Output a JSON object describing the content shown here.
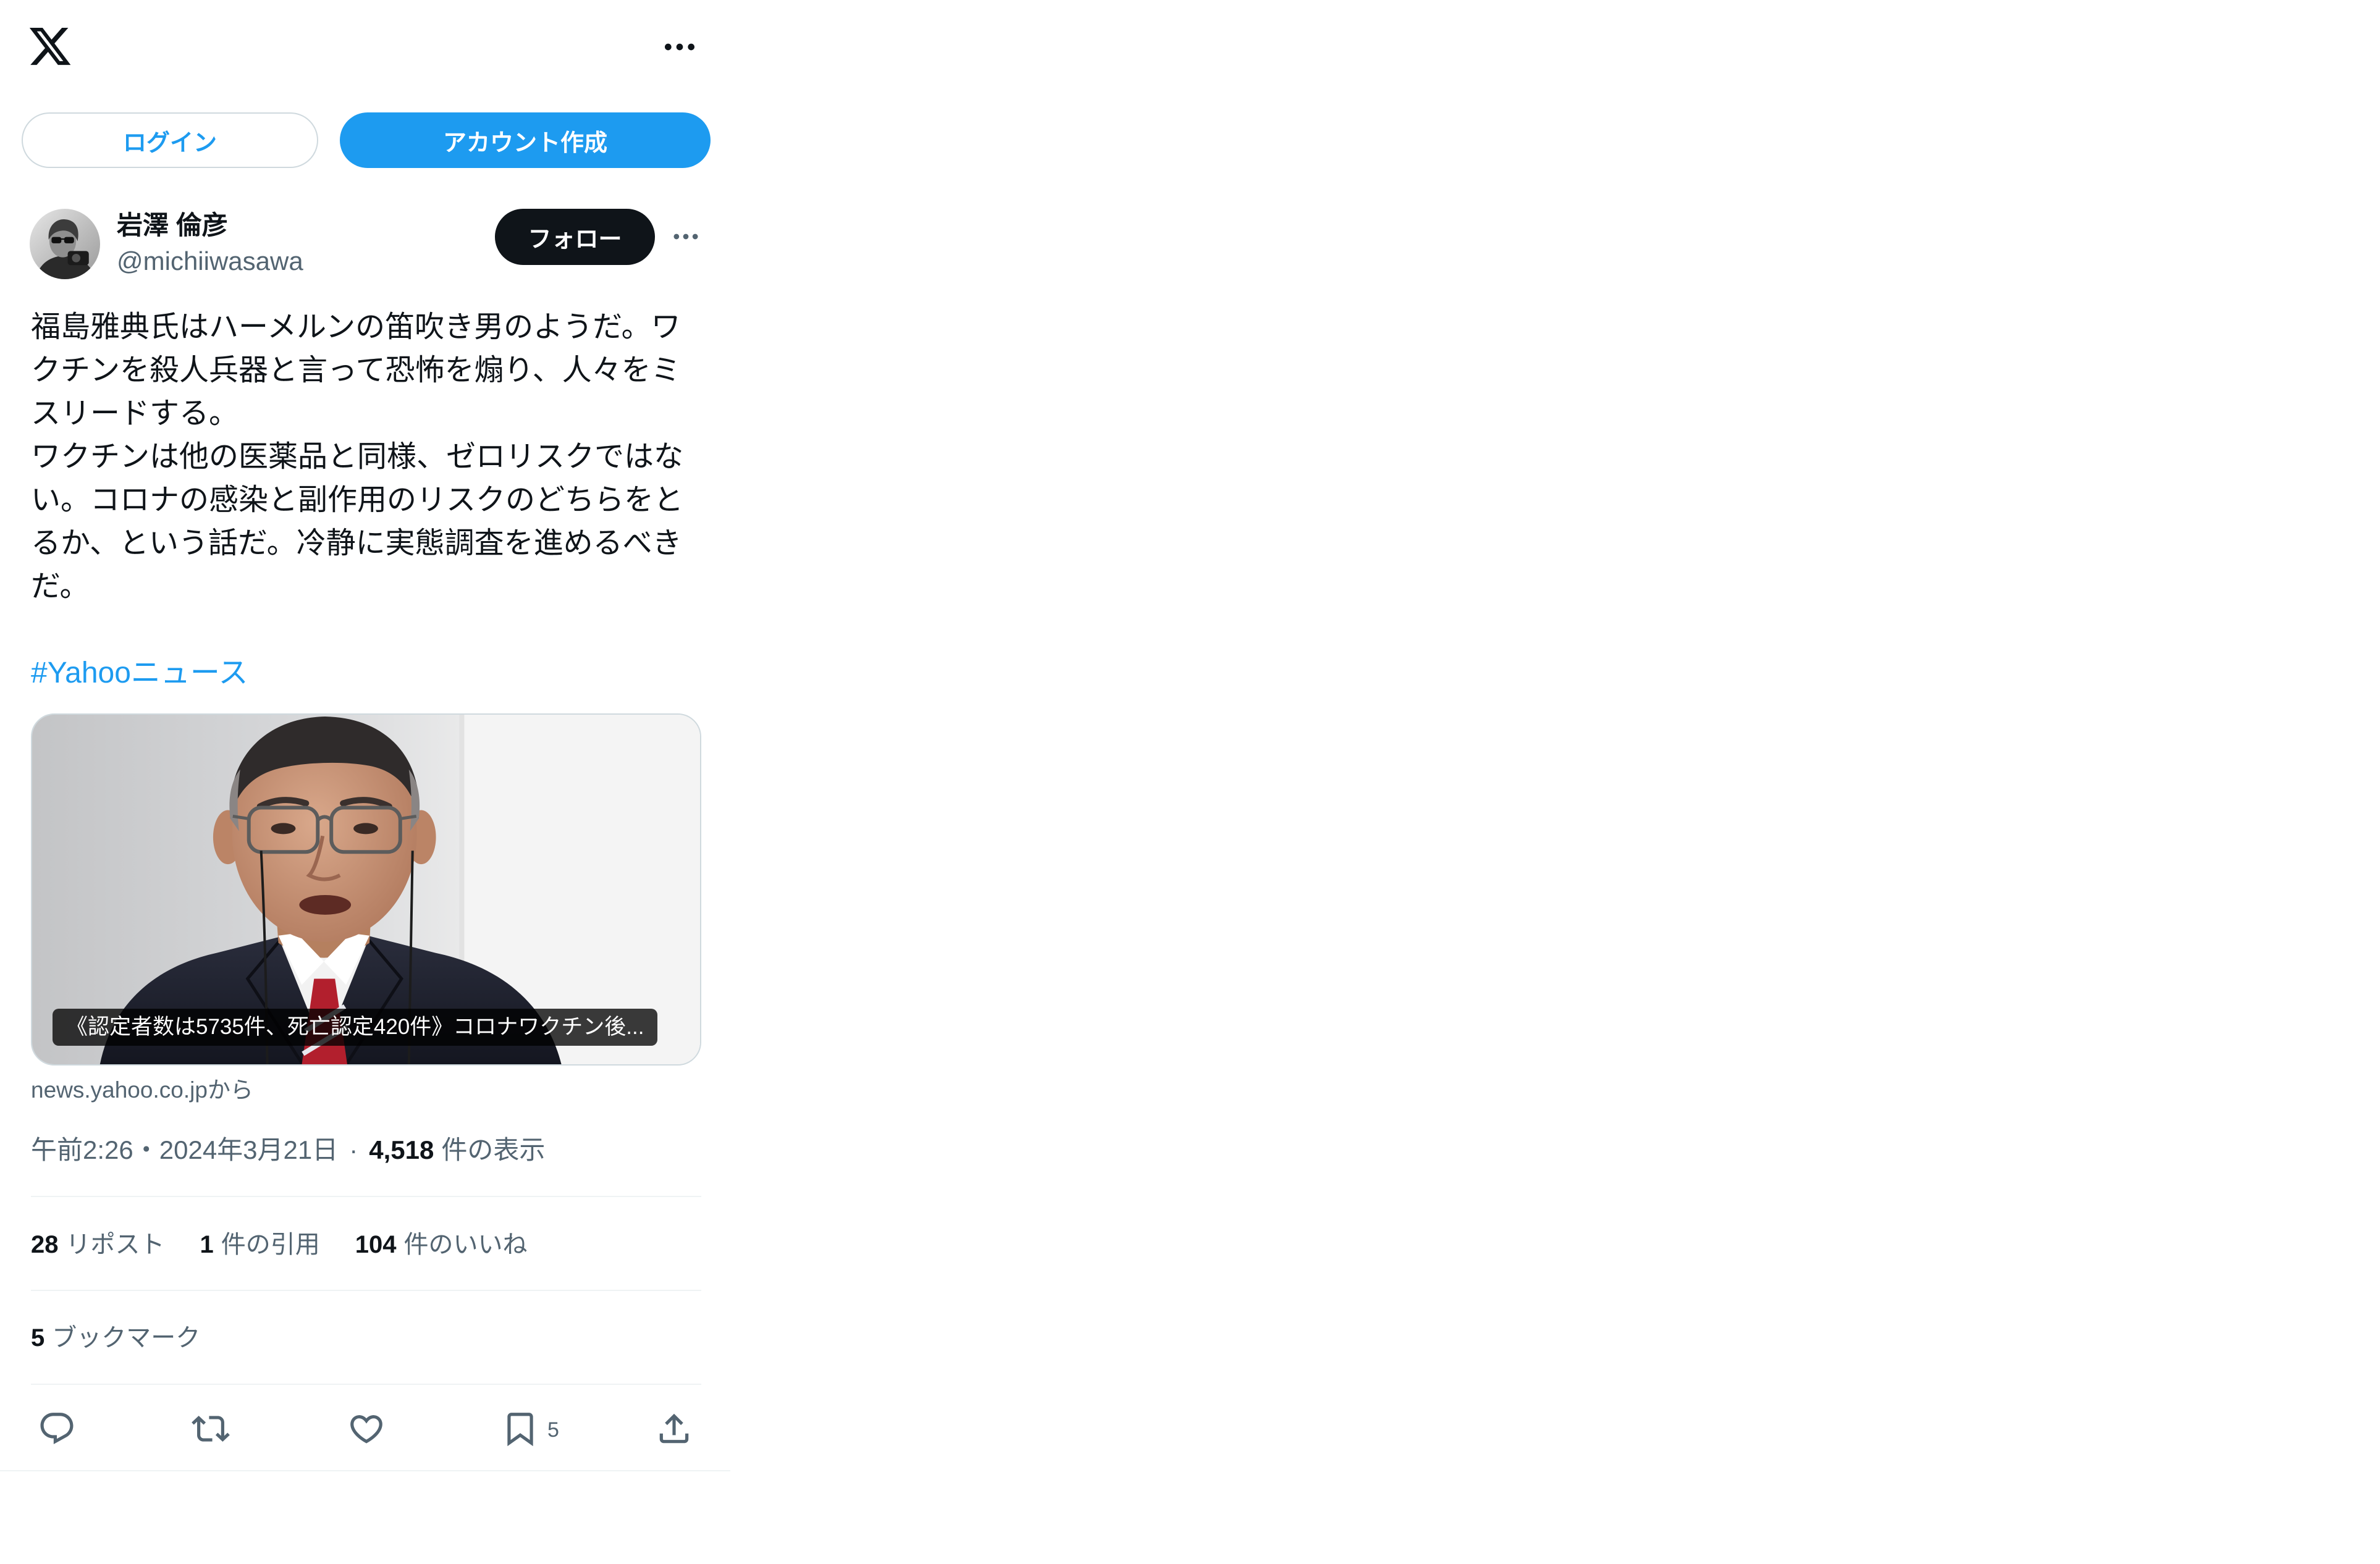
{
  "colors": {
    "accent": "#1d9bf0",
    "text": "#0f1419",
    "secondary": "#536471",
    "divider": "#eff3f4",
    "outline": "#cfd9de",
    "follow_background": "#0f1419",
    "caption_background": "rgba(0,0,0,0.77)"
  },
  "icons": {
    "logo": "x-logo-icon",
    "top_more": "more-horizontal-icon",
    "tweet_more": "more-horizontal-icon",
    "reply": "reply-icon",
    "repost": "repost-icon",
    "like": "heart-icon",
    "bookmark": "bookmark-icon",
    "share": "share-icon"
  },
  "auth": {
    "login_label": "ログイン",
    "signup_label": "アカウント作成"
  },
  "tweet": {
    "author": {
      "name": "岩澤 倫彦",
      "handle": "@michiiwasawa"
    },
    "follow_label": "フォロー",
    "text": [
      "福島雅典氏はハーメルンの笛吹き男のようだ。ワクチンを殺人兵器と言って恐怖を煽り、人々をミスリードする。",
      "ワクチンは他の医薬品と同様、ゼロリスクではない。コロナの感染と副作用のリスクのどちらをとるか、という話だ。冷静に実態調査を進めるべきだ。"
    ],
    "hashtag": "#Yahooニュース",
    "card": {
      "title": "《認定者数は5735件、死亡認定420件》コロナワクチン後...",
      "source": "news.yahoo.co.jpから"
    },
    "meta": {
      "timestamp": "午前2:26・2024年3月21日",
      "separator": "·",
      "views_count": "4,518",
      "views_label": "件の表示"
    },
    "stats": {
      "reposts": {
        "count": "28",
        "label": "リポスト"
      },
      "quotes": {
        "count": "1",
        "label": "件の引用"
      },
      "likes": {
        "count": "104",
        "label": "件のいいね"
      },
      "bookmarks": {
        "count": "5",
        "label": "ブックマーク"
      }
    },
    "actions": {
      "bookmark_count": "5"
    }
  }
}
